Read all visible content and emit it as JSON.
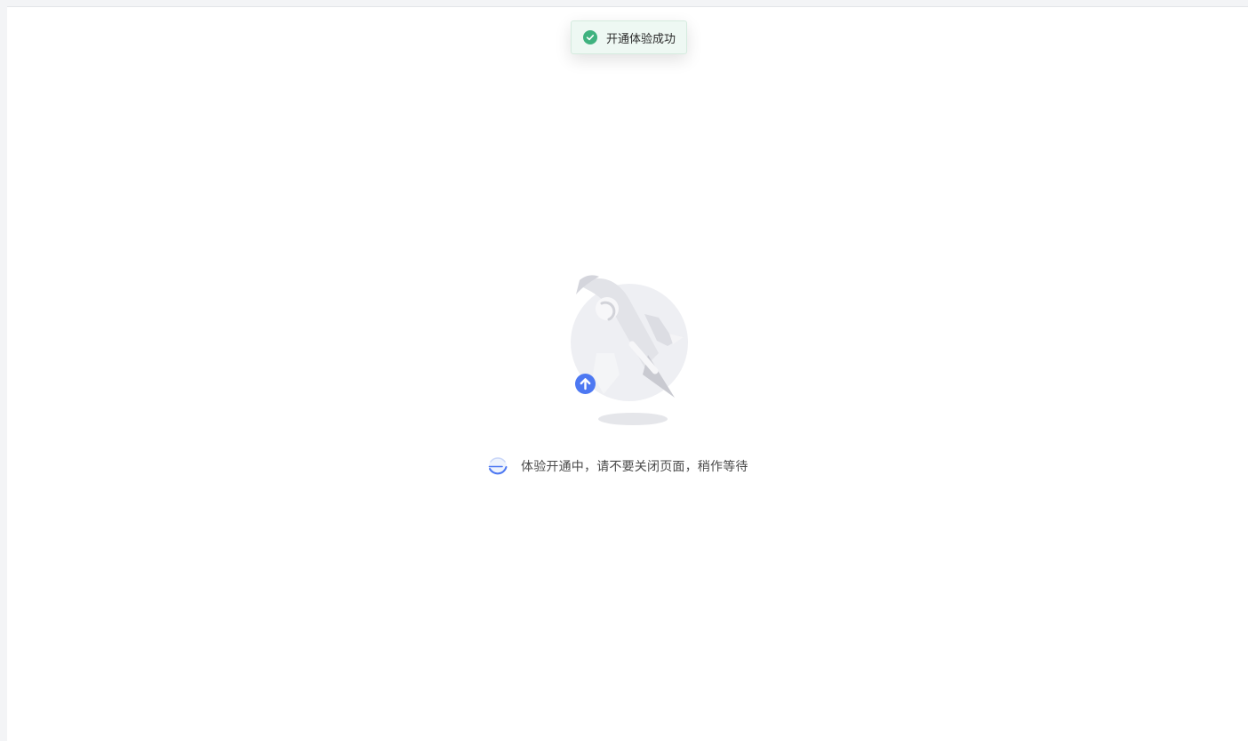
{
  "toast": {
    "message": "开通体验成功",
    "icon": "check-circle-icon",
    "color": "#3fb27f"
  },
  "illustration": {
    "icons": [
      "rocket-illustration",
      "upload-arrow-icon"
    ],
    "accent_color": "#4d78f2"
  },
  "loading": {
    "icon": "spinner-icon",
    "message": "体验开通中，请不要关闭页面，稍作等待"
  }
}
